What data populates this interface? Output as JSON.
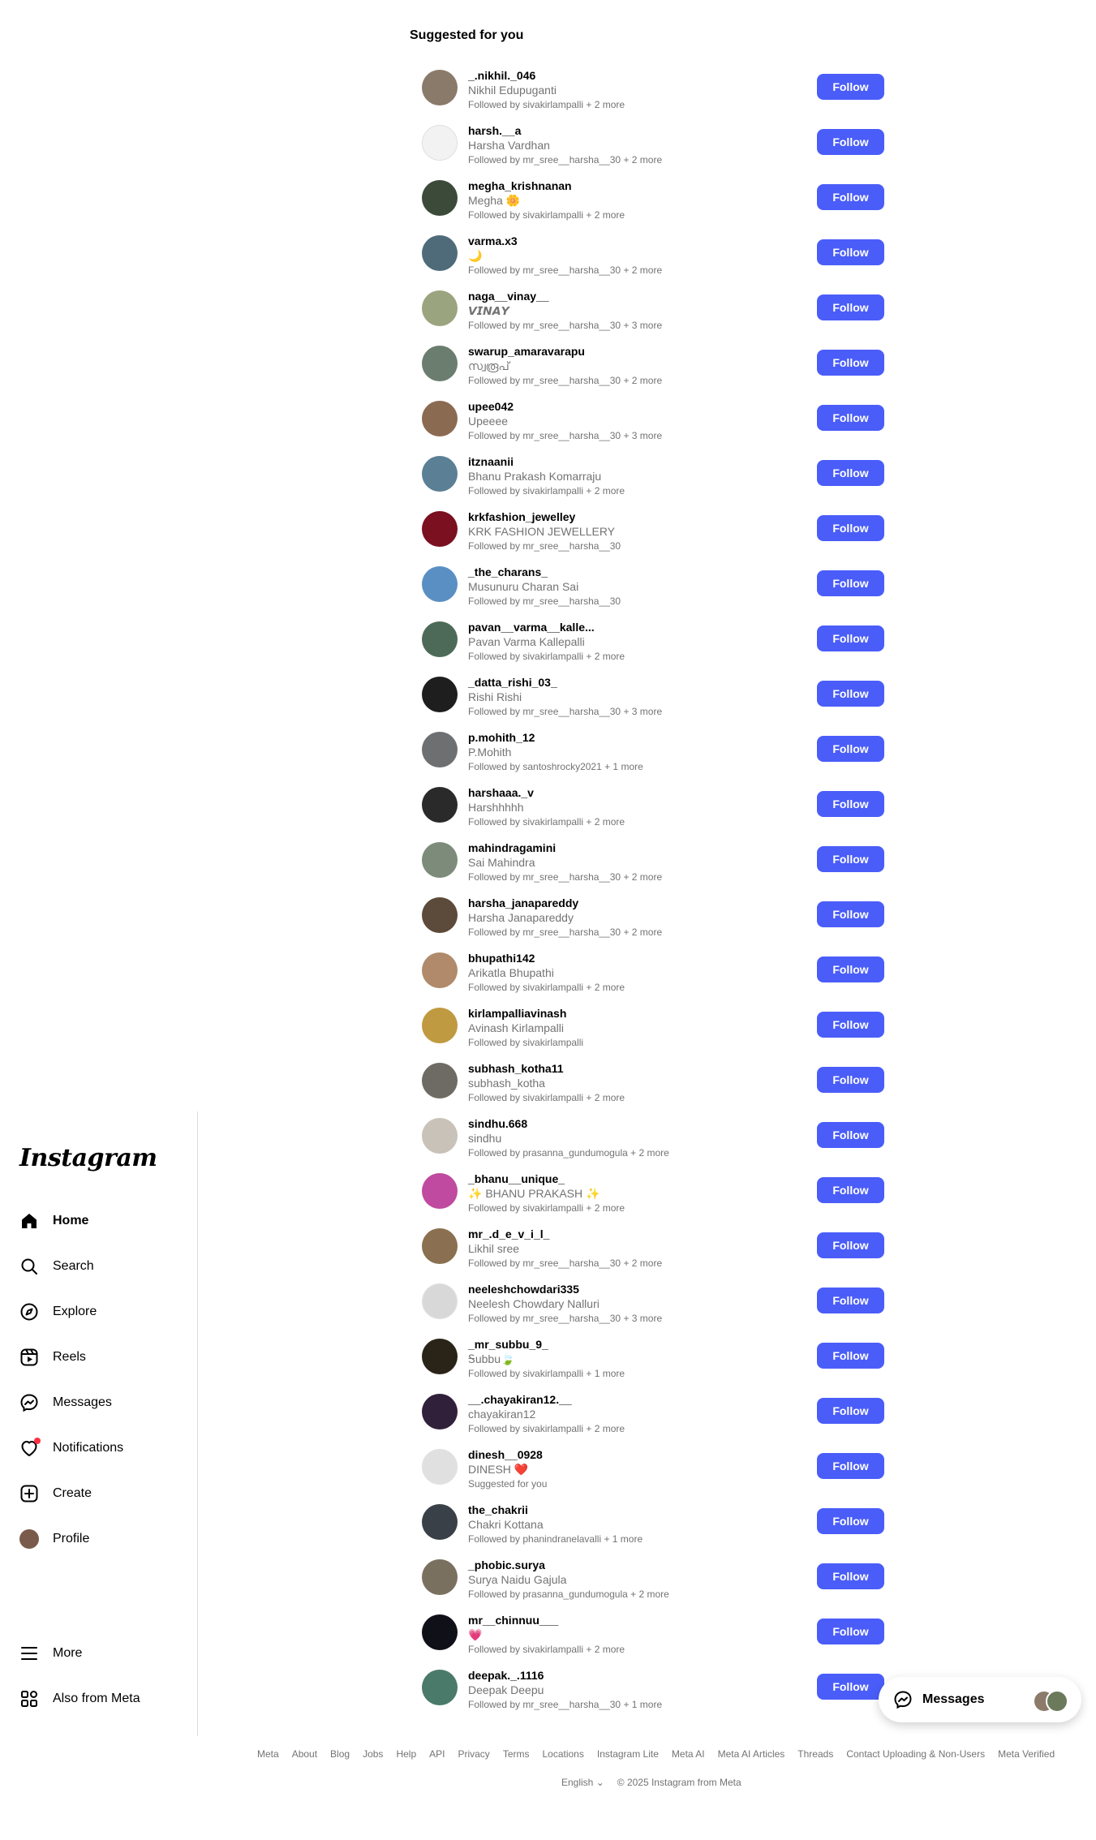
{
  "sidebar": {
    "logo": "Instagram",
    "nav": [
      {
        "label": "Home",
        "icon": "home-icon",
        "active": true
      },
      {
        "label": "Search",
        "icon": "search-icon"
      },
      {
        "label": "Explore",
        "icon": "compass-icon"
      },
      {
        "label": "Reels",
        "icon": "reels-icon"
      },
      {
        "label": "Messages",
        "icon": "messenger-icon"
      },
      {
        "label": "Notifications",
        "icon": "heart-icon"
      },
      {
        "label": "Create",
        "icon": "plus-square-icon"
      },
      {
        "label": "Profile",
        "icon": "profile-avatar"
      }
    ],
    "bottom": [
      {
        "label": "More",
        "icon": "menu-icon"
      },
      {
        "label": "Also from Meta",
        "icon": "meta-apps-icon"
      }
    ]
  },
  "main": {
    "title": "Suggested for you",
    "follow_label": "Follow",
    "suggestions": [
      {
        "username": "_.nikhil._046",
        "name": "Nikhil Edupuganti",
        "followed_by": "Followed by sivakirlampalli + 2 more",
        "avatar_color": "#8a7a6a"
      },
      {
        "username": "harsh.__a",
        "name": "Harsha Vardhan",
        "followed_by": "Followed by mr_sree__harsha__30 + 2 more",
        "avatar_color": "#f2f2f2"
      },
      {
        "username": "megha_krishnanan",
        "name": "Megha 🌼",
        "followed_by": "Followed by sivakirlampalli + 2 more",
        "avatar_color": "#3c4a3a"
      },
      {
        "username": "varma.x3",
        "name": "🌙",
        "followed_by": "Followed by mr_sree__harsha__30 + 2 more",
        "avatar_color": "#4f6b7a"
      },
      {
        "username": "naga__vinay__",
        "name": "𝙑𝙄𝙉𝘼𝙔",
        "followed_by": "Followed by mr_sree__harsha__30 + 3 more",
        "avatar_color": "#9aa57f"
      },
      {
        "username": "swarup_amaravarapu",
        "name": "സ്വരൂപ്",
        "followed_by": "Followed by mr_sree__harsha__30 + 2 more",
        "avatar_color": "#6b7d6e"
      },
      {
        "username": "upee042",
        "name": "Upeeee",
        "followed_by": "Followed by mr_sree__harsha__30 + 3 more",
        "avatar_color": "#8b6a52"
      },
      {
        "username": "itznaanii",
        "name": "Bhanu Prakash Komarraju",
        "followed_by": "Followed by sivakirlampalli + 2 more",
        "avatar_color": "#5b7f95"
      },
      {
        "username": "krkfashion_jewelley",
        "name": "KRK FASHION JEWELLERY",
        "followed_by": "Followed by mr_sree__harsha__30",
        "avatar_color": "#7a1020"
      },
      {
        "username": "_the_charans_",
        "name": "Musunuru Charan Sai",
        "followed_by": "Followed by mr_sree__harsha__30",
        "avatar_color": "#5a8fc4"
      },
      {
        "username": "pavan__varma__kalle...",
        "name": "Pavan Varma Kallepalli",
        "followed_by": "Followed by sivakirlampalli + 2 more",
        "avatar_color": "#4d6a58"
      },
      {
        "username": "_datta_rishi_03_",
        "name": "Rishi Rishi",
        "followed_by": "Followed by mr_sree__harsha__30 + 3 more",
        "avatar_color": "#1e1e1e"
      },
      {
        "username": "p.mohith_12",
        "name": "P.Mohith",
        "followed_by": "Followed by santoshrocky2021 + 1 more",
        "avatar_color": "#6d6f70"
      },
      {
        "username": "harshaaa._v",
        "name": "Harshhhhh",
        "followed_by": "Followed by sivakirlampalli + 2 more",
        "avatar_color": "#2a2a2a"
      },
      {
        "username": "mahindragamini",
        "name": "Sai Mahindra",
        "followed_by": "Followed by mr_sree__harsha__30 + 2 more",
        "avatar_color": "#7c8b7a"
      },
      {
        "username": "harsha_janapareddy",
        "name": "Harsha Janapareddy",
        "followed_by": "Followed by mr_sree__harsha__30 + 2 more",
        "avatar_color": "#5c4a3a"
      },
      {
        "username": "bhupathi142",
        "name": "Arikatla Bhupathi",
        "followed_by": "Followed by sivakirlampalli + 2 more",
        "avatar_color": "#b08a6a"
      },
      {
        "username": "kirlampalliavinash",
        "name": "Avinash Kirlampalli",
        "followed_by": "Followed by sivakirlampalli",
        "avatar_color": "#c09a40"
      },
      {
        "username": "subhash_kotha11",
        "name": "subhash_kotha",
        "followed_by": "Followed by sivakirlampalli + 2 more",
        "avatar_color": "#6e6a64"
      },
      {
        "username": "sindhu.668",
        "name": "sindhu",
        "followed_by": "Followed by prasanna_gundumogula + 2 more",
        "avatar_color": "#c8c2b8"
      },
      {
        "username": "_bhanu__unique_",
        "name": "✨ BHANU PRAKASH ✨",
        "followed_by": "Followed by sivakirlampalli + 2 more",
        "avatar_color": "#c04aa0"
      },
      {
        "username": "mr_.d_e_v_i_l_",
        "name": "Likhil sree",
        "followed_by": "Followed by mr_sree__harsha__30 + 2 more",
        "avatar_color": "#8a7050"
      },
      {
        "username": "neeleshchowdari335",
        "name": "Neelesh Chowdary Nalluri",
        "followed_by": "Followed by mr_sree__harsha__30 + 3 more",
        "avatar_color": "#d8d8d8"
      },
      {
        "username": "_mr_subbu_9_",
        "name": "Ꭶubbu🍃",
        "followed_by": "Followed by sivakirlampalli + 1 more",
        "avatar_color": "#2a2418"
      },
      {
        "username": "__.chayakiran12.__",
        "name": "chayakiran12",
        "followed_by": "Followed by sivakirlampalli + 2 more",
        "avatar_color": "#30203a"
      },
      {
        "username": "dinesh__0928",
        "name": "DINESH ❤️",
        "followed_by": "Suggested for you",
        "avatar_color": "#e0e0e0"
      },
      {
        "username": "the_chakrii",
        "name": "Chakri Kottana",
        "followed_by": "Followed by phanindranelavalli + 1 more",
        "avatar_color": "#3a4048"
      },
      {
        "username": "_phobic.surya",
        "name": "Surya Naidu Gajula",
        "followed_by": "Followed by prasanna_gundumogula + 2 more",
        "avatar_color": "#7a7060"
      },
      {
        "username": "mr__chinnuu___",
        "name": "💗",
        "followed_by": "Followed by sivakirlampalli + 2 more",
        "avatar_color": "#101018"
      },
      {
        "username": "deepak._.1116",
        "name": "Deepak Deepu",
        "followed_by": "Followed by mr_sree__harsha__30 + 1 more",
        "avatar_color": "#4a7a6a"
      }
    ]
  },
  "footer": {
    "links": [
      "Meta",
      "About",
      "Blog",
      "Jobs",
      "Help",
      "API",
      "Privacy",
      "Terms",
      "Locations",
      "Instagram Lite",
      "Meta AI",
      "Meta AI Articles",
      "Threads",
      "Contact Uploading & Non-Users",
      "Meta Verified"
    ],
    "language": "English",
    "copyright": "© 2025 Instagram from Meta"
  },
  "messages_pill": {
    "label": "Messages",
    "avatar_colors": [
      "#8c7a6a",
      "#6a7a5a"
    ]
  }
}
